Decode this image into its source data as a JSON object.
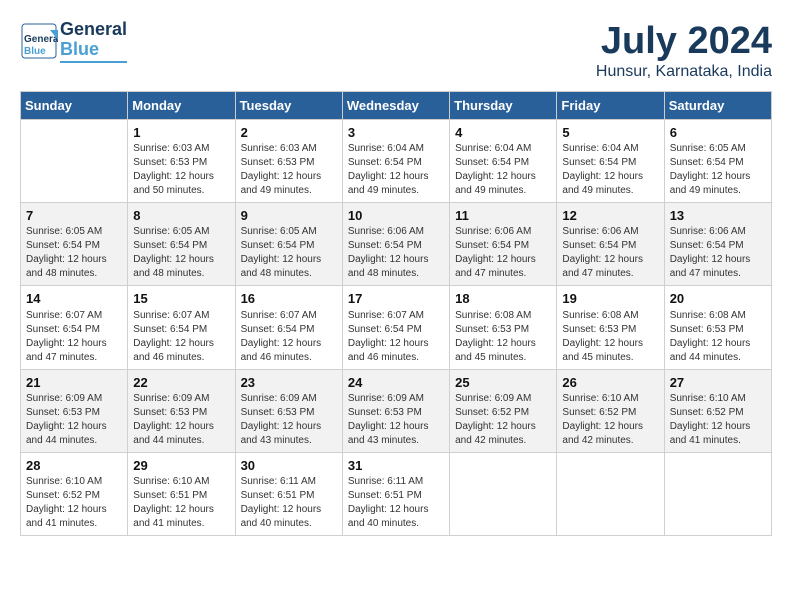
{
  "header": {
    "logo_general": "General",
    "logo_blue": "Blue",
    "month_year": "July 2024",
    "location": "Hunsur, Karnataka, India"
  },
  "days_of_week": [
    "Sunday",
    "Monday",
    "Tuesday",
    "Wednesday",
    "Thursday",
    "Friday",
    "Saturday"
  ],
  "weeks": [
    [
      {
        "day": "",
        "info": ""
      },
      {
        "day": "1",
        "info": "Sunrise: 6:03 AM\nSunset: 6:53 PM\nDaylight: 12 hours\nand 50 minutes."
      },
      {
        "day": "2",
        "info": "Sunrise: 6:03 AM\nSunset: 6:53 PM\nDaylight: 12 hours\nand 49 minutes."
      },
      {
        "day": "3",
        "info": "Sunrise: 6:04 AM\nSunset: 6:54 PM\nDaylight: 12 hours\nand 49 minutes."
      },
      {
        "day": "4",
        "info": "Sunrise: 6:04 AM\nSunset: 6:54 PM\nDaylight: 12 hours\nand 49 minutes."
      },
      {
        "day": "5",
        "info": "Sunrise: 6:04 AM\nSunset: 6:54 PM\nDaylight: 12 hours\nand 49 minutes."
      },
      {
        "day": "6",
        "info": "Sunrise: 6:05 AM\nSunset: 6:54 PM\nDaylight: 12 hours\nand 49 minutes."
      }
    ],
    [
      {
        "day": "7",
        "info": "Sunrise: 6:05 AM\nSunset: 6:54 PM\nDaylight: 12 hours\nand 48 minutes."
      },
      {
        "day": "8",
        "info": "Sunrise: 6:05 AM\nSunset: 6:54 PM\nDaylight: 12 hours\nand 48 minutes."
      },
      {
        "day": "9",
        "info": "Sunrise: 6:05 AM\nSunset: 6:54 PM\nDaylight: 12 hours\nand 48 minutes."
      },
      {
        "day": "10",
        "info": "Sunrise: 6:06 AM\nSunset: 6:54 PM\nDaylight: 12 hours\nand 48 minutes."
      },
      {
        "day": "11",
        "info": "Sunrise: 6:06 AM\nSunset: 6:54 PM\nDaylight: 12 hours\nand 47 minutes."
      },
      {
        "day": "12",
        "info": "Sunrise: 6:06 AM\nSunset: 6:54 PM\nDaylight: 12 hours\nand 47 minutes."
      },
      {
        "day": "13",
        "info": "Sunrise: 6:06 AM\nSunset: 6:54 PM\nDaylight: 12 hours\nand 47 minutes."
      }
    ],
    [
      {
        "day": "14",
        "info": "Sunrise: 6:07 AM\nSunset: 6:54 PM\nDaylight: 12 hours\nand 47 minutes."
      },
      {
        "day": "15",
        "info": "Sunrise: 6:07 AM\nSunset: 6:54 PM\nDaylight: 12 hours\nand 46 minutes."
      },
      {
        "day": "16",
        "info": "Sunrise: 6:07 AM\nSunset: 6:54 PM\nDaylight: 12 hours\nand 46 minutes."
      },
      {
        "day": "17",
        "info": "Sunrise: 6:07 AM\nSunset: 6:54 PM\nDaylight: 12 hours\nand 46 minutes."
      },
      {
        "day": "18",
        "info": "Sunrise: 6:08 AM\nSunset: 6:53 PM\nDaylight: 12 hours\nand 45 minutes."
      },
      {
        "day": "19",
        "info": "Sunrise: 6:08 AM\nSunset: 6:53 PM\nDaylight: 12 hours\nand 45 minutes."
      },
      {
        "day": "20",
        "info": "Sunrise: 6:08 AM\nSunset: 6:53 PM\nDaylight: 12 hours\nand 44 minutes."
      }
    ],
    [
      {
        "day": "21",
        "info": "Sunrise: 6:09 AM\nSunset: 6:53 PM\nDaylight: 12 hours\nand 44 minutes."
      },
      {
        "day": "22",
        "info": "Sunrise: 6:09 AM\nSunset: 6:53 PM\nDaylight: 12 hours\nand 44 minutes."
      },
      {
        "day": "23",
        "info": "Sunrise: 6:09 AM\nSunset: 6:53 PM\nDaylight: 12 hours\nand 43 minutes."
      },
      {
        "day": "24",
        "info": "Sunrise: 6:09 AM\nSunset: 6:53 PM\nDaylight: 12 hours\nand 43 minutes."
      },
      {
        "day": "25",
        "info": "Sunrise: 6:09 AM\nSunset: 6:52 PM\nDaylight: 12 hours\nand 42 minutes."
      },
      {
        "day": "26",
        "info": "Sunrise: 6:10 AM\nSunset: 6:52 PM\nDaylight: 12 hours\nand 42 minutes."
      },
      {
        "day": "27",
        "info": "Sunrise: 6:10 AM\nSunset: 6:52 PM\nDaylight: 12 hours\nand 41 minutes."
      }
    ],
    [
      {
        "day": "28",
        "info": "Sunrise: 6:10 AM\nSunset: 6:52 PM\nDaylight: 12 hours\nand 41 minutes."
      },
      {
        "day": "29",
        "info": "Sunrise: 6:10 AM\nSunset: 6:51 PM\nDaylight: 12 hours\nand 41 minutes."
      },
      {
        "day": "30",
        "info": "Sunrise: 6:11 AM\nSunset: 6:51 PM\nDaylight: 12 hours\nand 40 minutes."
      },
      {
        "day": "31",
        "info": "Sunrise: 6:11 AM\nSunset: 6:51 PM\nDaylight: 12 hours\nand 40 minutes."
      },
      {
        "day": "",
        "info": ""
      },
      {
        "day": "",
        "info": ""
      },
      {
        "day": "",
        "info": ""
      }
    ]
  ]
}
